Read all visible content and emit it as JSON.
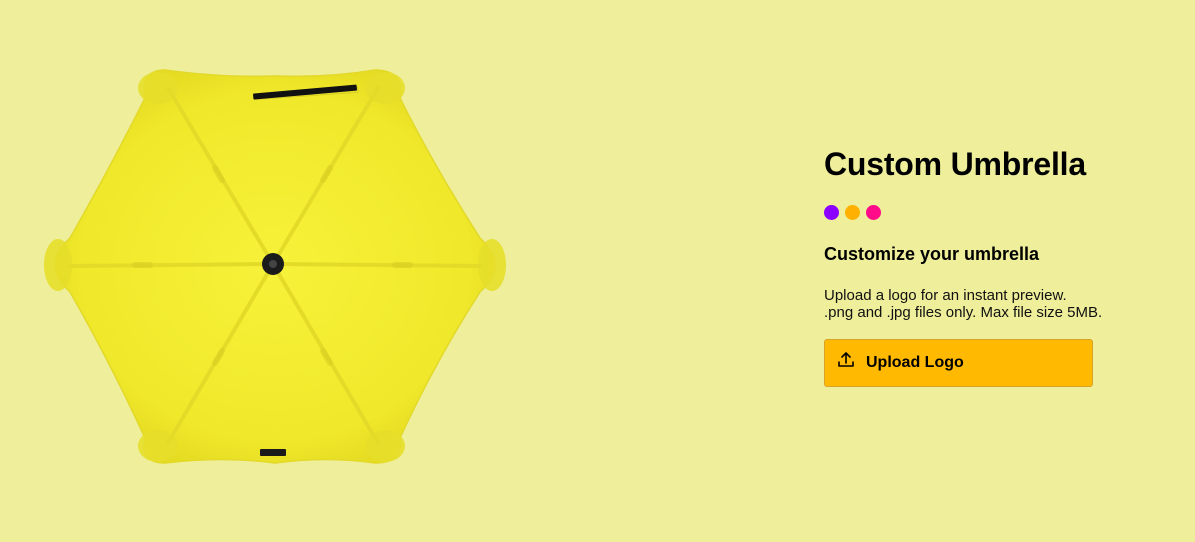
{
  "product": {
    "title": "Custom Umbrella",
    "subtitle": "Customize your umbrella",
    "help_lines": [
      "Upload a logo for an instant preview.",
      ".png and .jpg files only. Max file size 5MB."
    ],
    "upload_label": "Upload Logo",
    "upload_icon": "upload-icon",
    "swatches": [
      {
        "name": "purple",
        "color": "#8b00ff"
      },
      {
        "name": "orange",
        "color": "#ffb000"
      },
      {
        "name": "pink",
        "color": "#ff0a88"
      }
    ]
  },
  "theme": {
    "background": "#eeee9b",
    "umbrella_color": "#f5ec32",
    "button_color": "#ffb900"
  }
}
